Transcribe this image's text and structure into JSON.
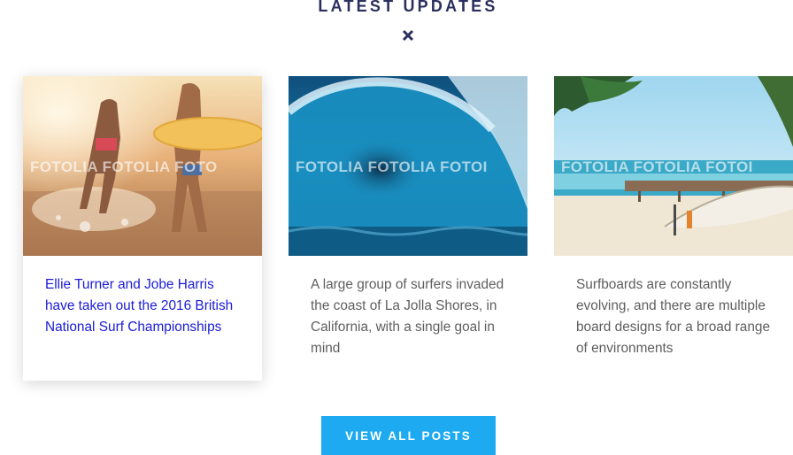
{
  "section": {
    "title": "LATEST UPDATES"
  },
  "icons": {
    "close": "close-icon"
  },
  "posts": [
    {
      "text": "Ellie Turner and Jobe Harris have taken out the 2016 British National Surf Championships",
      "image": "surfers-running-beach",
      "watermark": "FOTOLIA FOTOLIA FOTO",
      "active": true
    },
    {
      "text": "A large group of surfers invaded the coast of La Jolla Shores, in California, with a single goal in mind",
      "image": "ocean-wave-barrel",
      "watermark": "FOTOLIA FOTOLIA FOTOI",
      "active": false
    },
    {
      "text": "Surfboards are constantly evolving, and there are multiple board designs for a broad range of environments",
      "image": "surfboard-on-beach",
      "watermark": "FOTOLIA FOTOLIA FOTOI",
      "active": false
    }
  ],
  "cta": {
    "label": "VIEW ALL POSTS"
  },
  "colors": {
    "title": "#2a2f5e",
    "active_link": "#1b1bd6",
    "body_text": "#5e5e5e",
    "button": "#1daaf0"
  }
}
